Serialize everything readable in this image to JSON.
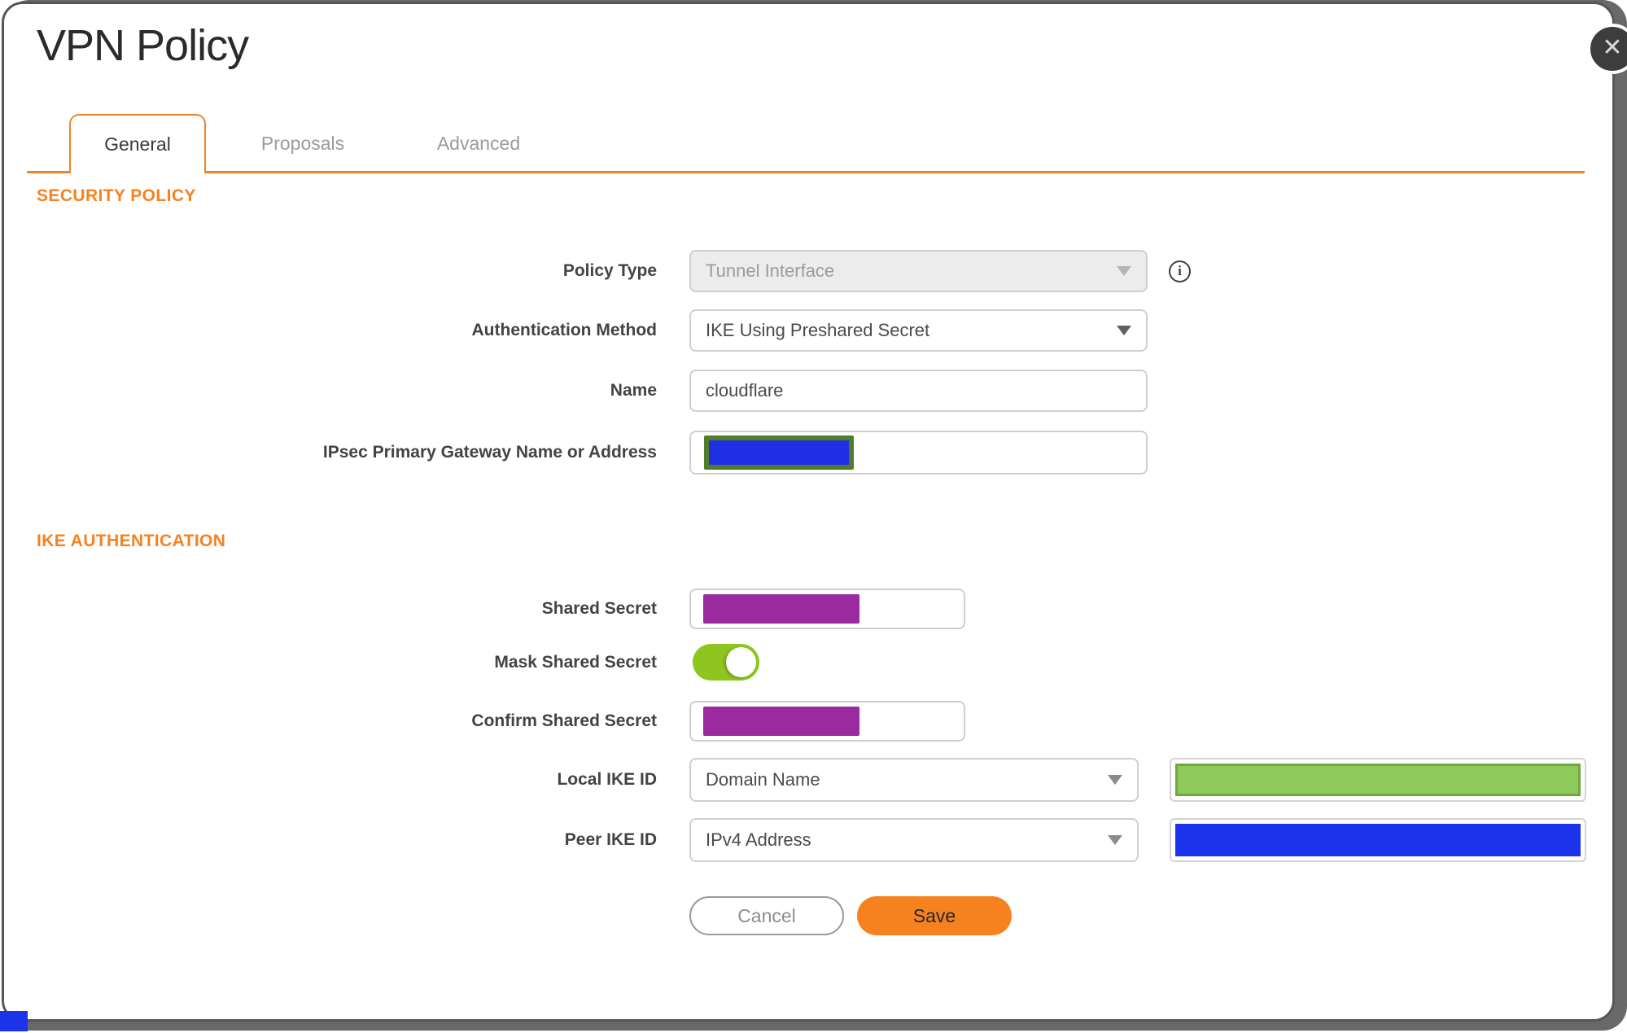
{
  "dialog": {
    "title": "VPN Policy",
    "close_icon": "✕",
    "info_glyph": "i"
  },
  "tabs": [
    {
      "label": "General",
      "active": true
    },
    {
      "label": "Proposals",
      "active": false
    },
    {
      "label": "Advanced",
      "active": false
    }
  ],
  "sections": {
    "security_policy": "SECURITY POLICY",
    "ike_authentication": "IKE AUTHENTICATION"
  },
  "fields": {
    "policy_type": {
      "label": "Policy Type",
      "value": "Tunnel Interface",
      "disabled": true
    },
    "authentication_method": {
      "label": "Authentication Method",
      "value": "IKE Using Preshared Secret"
    },
    "name": {
      "label": "Name",
      "value": "cloudflare"
    },
    "gateway": {
      "label": "IPsec Primary Gateway Name or Address",
      "value": "",
      "redacted": true
    },
    "shared_secret": {
      "label": "Shared Secret",
      "redacted": true
    },
    "mask_shared_secret": {
      "label": "Mask Shared Secret",
      "enabled": true
    },
    "confirm_shared_secret": {
      "label": "Confirm Shared Secret",
      "redacted": true
    },
    "local_ike_id": {
      "label": "Local IKE ID",
      "type_value": "Domain Name",
      "redacted": true
    },
    "peer_ike_id": {
      "label": "Peer IKE ID",
      "type_value": "IPv4 Address",
      "redacted": true
    }
  },
  "buttons": {
    "cancel": "Cancel",
    "save": "Save"
  },
  "colors": {
    "accent_orange": "#F6821F",
    "toggle_green": "#8EC61F",
    "redaction_purple": "#9B2AA0",
    "redaction_blue": "#1C33EC",
    "redaction_green_fill": "#8FC95C",
    "redaction_green_border": "#70A83C",
    "gateway_redaction_border": "#4F7D2A",
    "page_behind_grey": "#696969"
  }
}
